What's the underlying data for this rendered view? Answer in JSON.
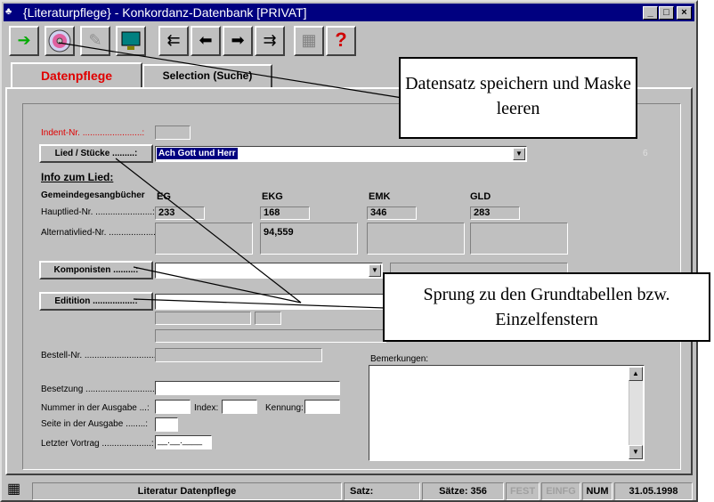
{
  "window": {
    "title": "{Literaturpflege} -   Konkordanz-Datenbank [PRIVAT]",
    "min": "_",
    "max": "□",
    "close": "×"
  },
  "toolbar": {
    "icons": [
      "exit-icon",
      "cd-icon",
      "tools-icon",
      "monitor-icon",
      "first-record-icon",
      "prev-record-icon",
      "next-record-icon",
      "last-record-icon",
      "calculator-icon",
      "help-icon"
    ]
  },
  "tabs": [
    {
      "label": "Datenpflege",
      "active": true
    },
    {
      "label": "Selection (Suche)",
      "active": false
    }
  ],
  "callouts": {
    "save": "Datensatz speichern und Maske leeren",
    "jump": "Sprung zu den Grundtabellen bzw. Einzelfenstern"
  },
  "form": {
    "indent_label": "Indent-Nr. ........................:",
    "lied_button": "Lied / Stücke .........:",
    "lied_value": "Ach Gott und Herr",
    "counter": "6",
    "info_heading": "Info zum Lied:",
    "gemeinde_label": "Gemeindegesangbücher",
    "columns": [
      "EG",
      "EKG",
      "EMK",
      "GLD"
    ],
    "hauptlied_label": "Hauptlied-Nr. .......................:",
    "hauptlied_values": [
      "233",
      "168",
      "346",
      "283"
    ],
    "alternativ_label": "Alternativlied-Nr. ...................:",
    "alternativ_values": [
      "",
      "94,559",
      "",
      ""
    ],
    "komponisten_button": "Komponisten .........:",
    "edition_button": "Editition .................:",
    "bestell_label": "Bestell-Nr. ..............................:",
    "bemerkungen_label": "Bemerkungen:",
    "besetzung_label": "Besetzung .............................:",
    "nummer_label": "Nummer in der Ausgabe ...:",
    "index_label": "Index:",
    "kennung_label": "Kennung:",
    "seite_label": "Seite in der Ausgabe ........:",
    "vortrag_label": "Letzter Vortrag ....................:",
    "vortrag_value": "__.__.____"
  },
  "status": {
    "title": "Literatur Datenpflege",
    "satz": "Satz:",
    "saetze": "Sätze: 356",
    "fest": "FEST",
    "einfg": "EINFG",
    "num": "NUM",
    "date": "31.05.1998"
  }
}
